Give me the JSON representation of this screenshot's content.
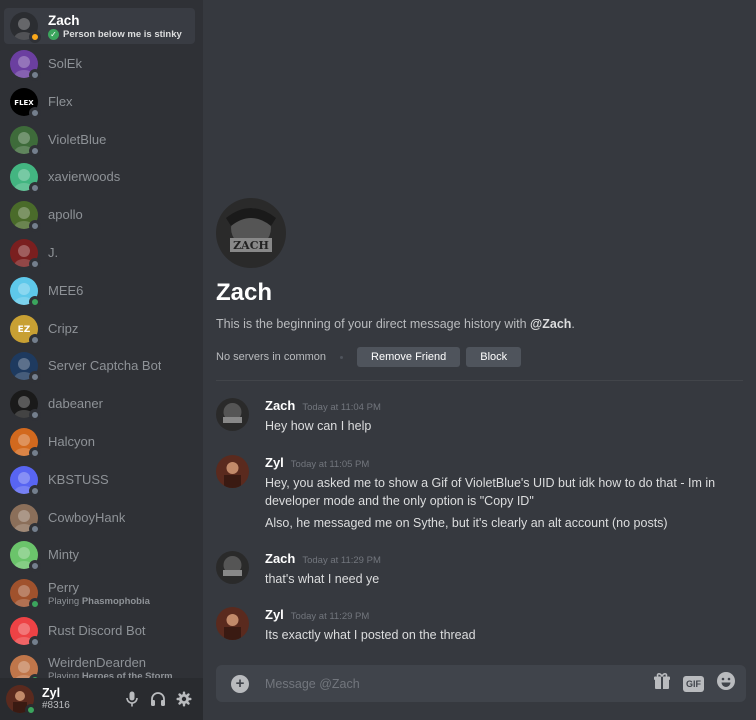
{
  "sidebar": {
    "items": [
      {
        "name": "Zach",
        "sub": "Person below me is stinky",
        "status": "idle",
        "active": true,
        "avatar_color": "#2b2d31"
      },
      {
        "name": "SolEk",
        "status": "offline",
        "avatar_color": "#6b3fa0"
      },
      {
        "name": "Flex",
        "status": "offline",
        "avatar_color": "#000000",
        "avatar_text": "FLEX"
      },
      {
        "name": "VioletBlue",
        "status": "offline",
        "avatar_color": "#3e6b3a"
      },
      {
        "name": "xavierwoods",
        "status": "offline",
        "avatar_color": "#43b581"
      },
      {
        "name": "apollo",
        "status": "offline",
        "avatar_color": "#4a6b2a"
      },
      {
        "name": "J.",
        "status": "offline",
        "avatar_color": "#7a1f1f"
      },
      {
        "name": "MEE6",
        "status": "online",
        "avatar_color": "#5ec8ea"
      },
      {
        "name": "Cripz",
        "status": "offline",
        "avatar_color": "#c8a033",
        "avatar_text": "EZ"
      },
      {
        "name": "Server Captcha Bot",
        "status": "offline",
        "avatar_color": "#1e3a5f"
      },
      {
        "name": "dabeaner",
        "status": "offline",
        "avatar_color": "#1a1a1a"
      },
      {
        "name": "Halcyon",
        "status": "offline",
        "avatar_color": "#d2691e"
      },
      {
        "name": "KBSTUSS",
        "status": "offline",
        "avatar_color": "#5865f2"
      },
      {
        "name": "CowboyHank",
        "status": "offline",
        "avatar_color": "#8b6f5a"
      },
      {
        "name": "Minty",
        "status": "offline",
        "avatar_color": "#6bc46b"
      },
      {
        "name": "Perry",
        "sub_prefix": "Playing ",
        "sub_bold": "Phasmophobia",
        "status": "online",
        "avatar_color": "#a0522d"
      },
      {
        "name": "Rust Discord Bot",
        "status": "offline",
        "avatar_color": "#ed4245"
      },
      {
        "name": "WeirdenDearden",
        "sub_prefix": "Playing ",
        "sub_bold": "Heroes of the Storm",
        "status": "online",
        "avatar_color": "#c0764a"
      }
    ]
  },
  "user_panel": {
    "name": "Zyl",
    "tag": "#8316",
    "status": "online",
    "icons": [
      "microphone-icon",
      "headphones-icon",
      "gear-icon"
    ]
  },
  "welcome": {
    "name": "Zach",
    "text_prefix": "This is the beginning of your direct message history with ",
    "text_mention": "@Zach",
    "text_suffix": ".",
    "no_servers": "No servers in common",
    "remove_friend": "Remove Friend",
    "block": "Block"
  },
  "messages": [
    {
      "author": "Zach",
      "time": "Today at 11:04 PM",
      "lines": [
        "Hey how can I help"
      ]
    },
    {
      "author": "Zyl",
      "time": "Today at 11:05 PM",
      "lines": [
        "Hey, you asked me to show a Gif of VioletBlue's UID but idk how to do that - Im in developer mode and the only option is \"Copy ID\"",
        "Also, he messaged me on Sythe, but it's clearly an alt account (no posts)"
      ]
    },
    {
      "author": "Zach",
      "time": "Today at 11:29 PM",
      "lines": [
        "that's what I need ye"
      ]
    },
    {
      "author": "Zyl",
      "time": "Today at 11:29 PM",
      "lines": [
        "Its exactly what I posted on the thread"
      ]
    }
  ],
  "composer": {
    "placeholder": "Message @Zach",
    "gif_label": "GIF",
    "icons": [
      "add-icon",
      "gift-icon",
      "gif-icon",
      "emoji-icon"
    ]
  },
  "colors": {
    "background": "#36393f",
    "sidebar": "#2f3136",
    "user_panel": "#292b2f",
    "online": "#3ba55d",
    "idle": "#faa81a",
    "offline": "#747f8d"
  }
}
